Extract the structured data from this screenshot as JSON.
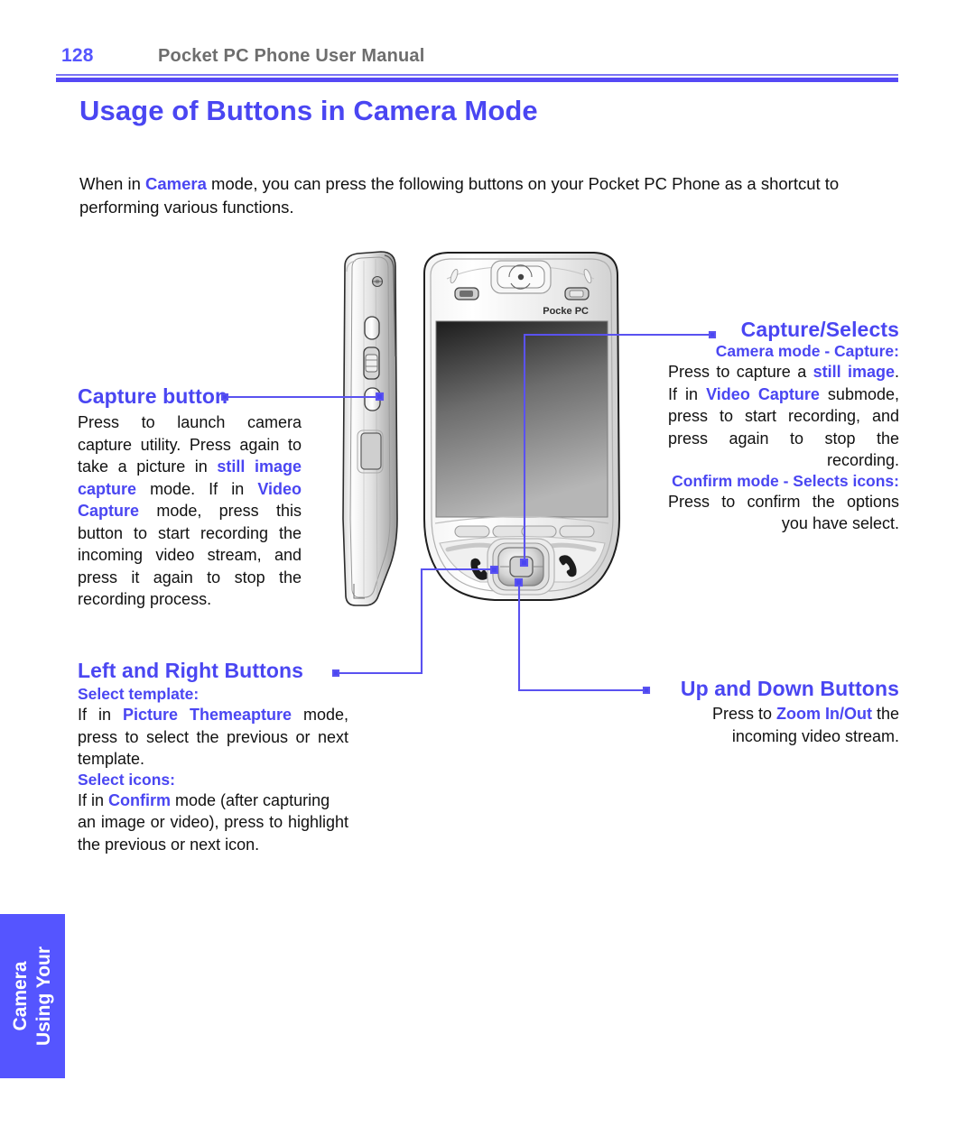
{
  "header": {
    "page_number": "128",
    "running_head": "Pocket PC Phone User Manual"
  },
  "title": "Usage of Buttons in Camera Mode",
  "intro": {
    "part1": "When in ",
    "highlight1": "Camera",
    "part2": " mode, you can press the following buttons on your Pocket PC Phone as a shortcut to performing various functions."
  },
  "callouts": {
    "capture_button": {
      "title": "Capture button",
      "body_1": "Press to launch camera capture utility.  Press again to take a picture in ",
      "hl_1": "still image  capture",
      "body_2": " mode. If in ",
      "hl_2": "Video Capture",
      "body_3": " mode, press this button to start recording the incoming video stream, and press it again to stop the recording process."
    },
    "left_right_buttons": {
      "title": "Left and Right Buttons",
      "sub_1": "Select template:",
      "body_1a": "If in ",
      "hl_1": "Picture Themeapture",
      "body_1b": " mode, press to select the previous or next template.",
      "sub_2": "Select icons:",
      "body_2a": "If in ",
      "hl_2": "Confirm",
      "body_2b": " mode (after capturing",
      "body_2c": "an image or video), press to highlight the previous or next icon."
    },
    "capture_selects": {
      "title": "Capture/Selects",
      "sub_1": "Camera mode - Capture:",
      "body_1a": "Press to capture a ",
      "hl_1": "still image",
      "body_1b": ".  If in ",
      "hl_2": "Video Capture",
      "body_1c": " submode, press to start recording, and press again to stop the recording.",
      "sub_2": "Confirm mode - Selects icons:",
      "body_2": "Press to confirm the options you have select."
    },
    "up_down_buttons": {
      "title": "Up and Down Buttons",
      "body_a": "Press to ",
      "hl_1": "Zoom In/Out",
      "body_b": " the incoming video stream."
    }
  },
  "illustration": {
    "brand_label": "Pocke PC"
  },
  "side_tab": {
    "line1": "Using Your",
    "line2": "Camera"
  },
  "colors": {
    "accent_blue": "#4a46f2",
    "tab_blue": "#5555ff",
    "rule_blue": "#5549f5",
    "running_head_gray": "#6e6e6e"
  }
}
